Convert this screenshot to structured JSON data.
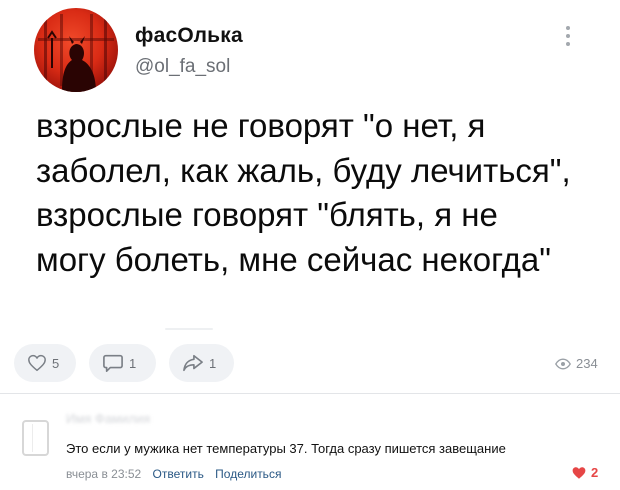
{
  "post": {
    "author_name": "фасОлька",
    "author_handle": "@ol_fa_sol",
    "text_lines": [
      "взрослые не говорят \"о нет, я",
      "заболел, как жаль, буду лечиться\",",
      "взрослые говорят \"блять, я не",
      "могу болеть, мне сейчас некогда\""
    ],
    "likes": "5",
    "comments": "1",
    "shares": "1",
    "views": "234",
    "icons": {
      "like": "heart-outline-icon",
      "comment": "speech-bubble-icon",
      "share": "share-arrow-icon",
      "views": "eye-icon",
      "more": "vertical-dots-icon"
    }
  },
  "comment": {
    "author_name": "Имя Фамилия",
    "text": "Это если у мужика нет температуры 37. Тогда сразу пишется завещание",
    "time": "вчера в 23:52",
    "reply_label": "Ответить",
    "share_label": "Поделиться",
    "likes": "2",
    "colors": {
      "like": "#e64646",
      "link": "#2a5885"
    }
  },
  "colors": {
    "avatar": "#d92b15",
    "action_bg": "#f0f2f5",
    "muted": "#6d7177"
  }
}
